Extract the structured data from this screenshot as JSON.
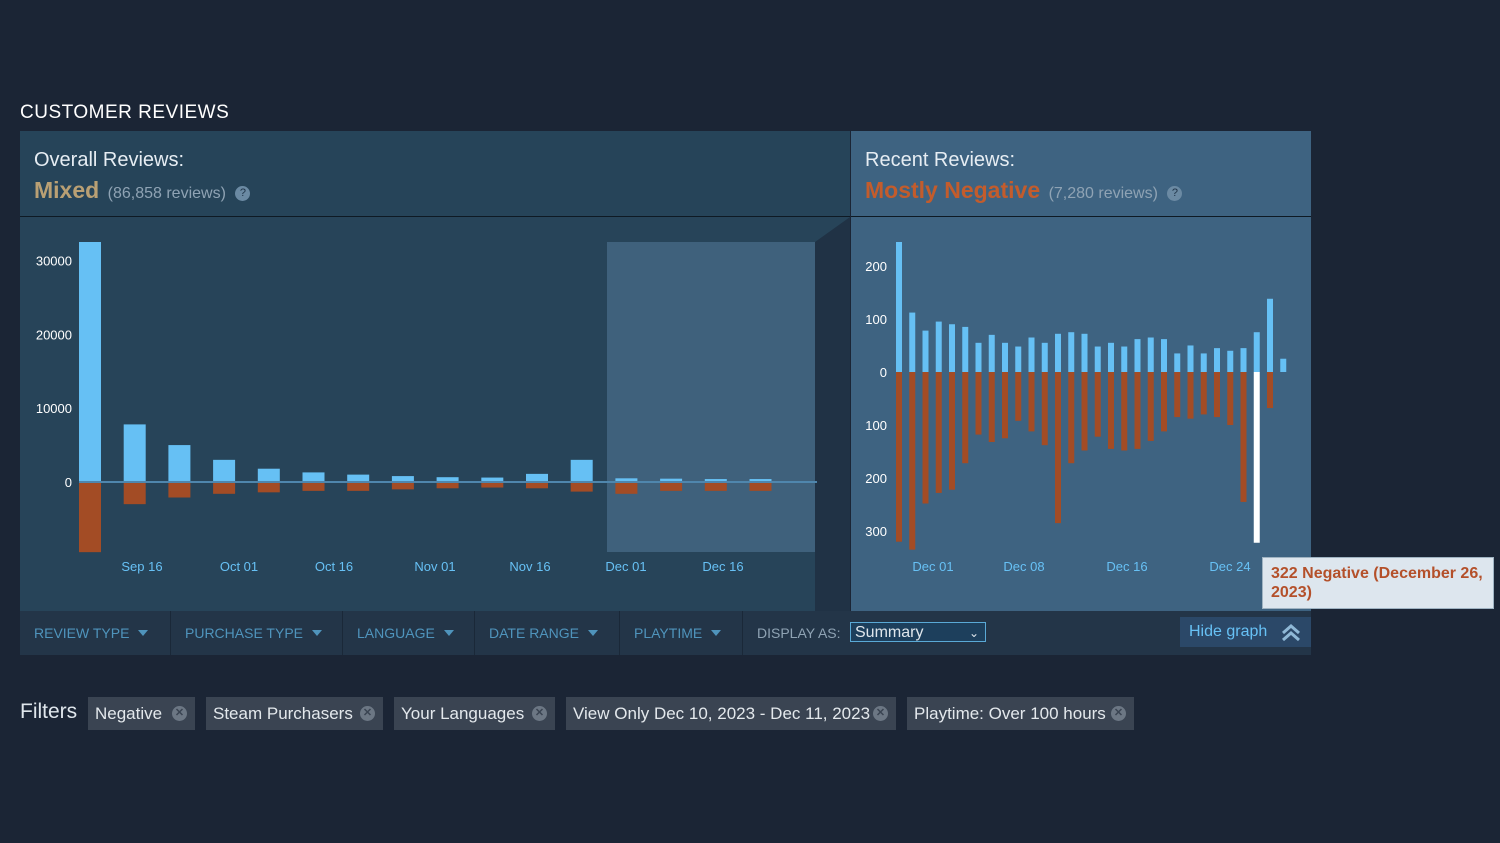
{
  "section_title": "CUSTOMER REVIEWS",
  "overall": {
    "label": "Overall Reviews:",
    "summary": "Mixed",
    "count": "(86,858 reviews)"
  },
  "recent": {
    "label": "Recent Reviews:",
    "summary": "Mostly Negative",
    "count": "(7,280 reviews)"
  },
  "help_icon": "?",
  "colors": {
    "positive": "#66c0f4",
    "negative": "#a34c25",
    "highlight": "#ffffff"
  },
  "filterbar": {
    "items": [
      "REVIEW TYPE",
      "PURCHASE TYPE",
      "LANGUAGE",
      "DATE RANGE",
      "PLAYTIME"
    ],
    "display_as_label": "DISPLAY AS:",
    "display_as_value": "Summary",
    "hide_graph": "Hide graph"
  },
  "tooltip": "322 Negative (December 26, 2023)",
  "filters": {
    "label": "Filters",
    "chips": [
      "Negative",
      "Steam Purchasers",
      "Your Languages",
      "View Only Dec 10, 2023 - Dec 11, 2023",
      "Playtime: Over 100 hours"
    ]
  },
  "chart_data": [
    {
      "type": "bar",
      "title": "Overall Reviews",
      "y_tick_labels": [
        "30000",
        "20000",
        "10000",
        "0"
      ],
      "x_tick_labels": [
        "Sep 16",
        "Oct 01",
        "Oct 16",
        "Nov 01",
        "Nov 16",
        "Dec 01",
        "Dec 16"
      ],
      "ylim": [
        -10000,
        32500
      ],
      "series": [
        {
          "name": "positive",
          "values": [
            32500,
            7800,
            5000,
            3000,
            1800,
            1300,
            1000,
            800,
            650,
            600,
            1100,
            3000,
            500,
            450,
            400,
            400
          ]
        },
        {
          "name": "negative",
          "values": [
            9500,
            3000,
            2100,
            1600,
            1400,
            1200,
            1200,
            1000,
            850,
            750,
            850,
            1300,
            1600,
            1200,
            1200,
            1200
          ]
        }
      ],
      "selected_range": "Dec 01 - Dec 16"
    },
    {
      "type": "bar",
      "title": "Recent Reviews",
      "y_tick_labels": [
        "200",
        "100",
        "0",
        "100",
        "200",
        "300"
      ],
      "x_tick_labels": [
        "Dec 01",
        "Dec 08",
        "Dec 16",
        "Dec 24"
      ],
      "ylim": [
        -330,
        245
      ],
      "series": [
        {
          "name": "positive",
          "values": [
            245,
            112,
            78,
            95,
            90,
            85,
            55,
            70,
            55,
            48,
            65,
            55,
            72,
            75,
            72,
            48,
            55,
            48,
            62,
            65,
            62,
            35,
            50,
            35,
            45,
            40,
            45,
            75,
            138,
            25
          ]
        },
        {
          "name": "negative",
          "values": [
            320,
            335,
            248,
            228,
            222,
            172,
            118,
            132,
            125,
            92,
            112,
            138,
            285,
            172,
            148,
            122,
            145,
            148,
            145,
            130,
            112,
            85,
            88,
            80,
            85,
            100,
            245,
            322,
            68
          ]
        }
      ],
      "highlighted": {
        "date": "December 26, 2023",
        "negative": 322
      }
    }
  ]
}
